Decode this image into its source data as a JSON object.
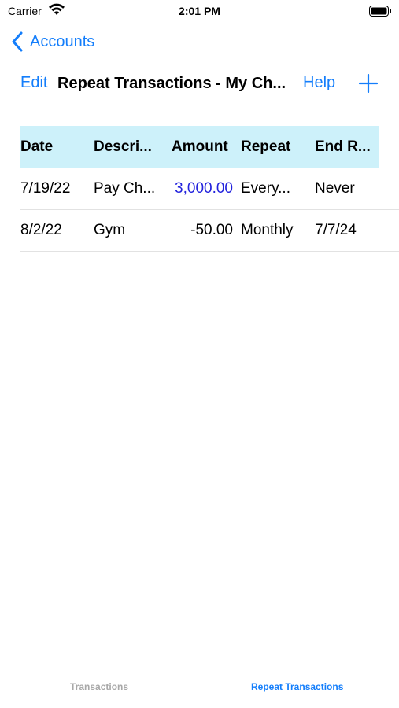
{
  "status_bar": {
    "carrier": "Carrier",
    "time": "2:01 PM"
  },
  "nav": {
    "back_label": "Accounts"
  },
  "toolbar": {
    "edit_label": "Edit",
    "title": "Repeat Transactions - My Ch...",
    "help_label": "Help"
  },
  "table": {
    "headers": {
      "date": "Date",
      "description": "Descri...",
      "amount": "Amount",
      "repeat": "Repeat",
      "end": "End R..."
    },
    "rows": [
      {
        "date": "7/19/22",
        "description": "Pay Ch...",
        "amount": "3,000.00",
        "repeat": "Every...",
        "end": "Never"
      },
      {
        "date": "8/2/22",
        "description": "Gym",
        "amount": "-50.00",
        "repeat": "Monthly",
        "end": "7/7/24"
      }
    ]
  },
  "tabbar": {
    "tabs": [
      {
        "label": "Transactions",
        "active": false
      },
      {
        "label": "Repeat Transactions",
        "active": true
      }
    ]
  },
  "colors": {
    "accent": "#147efb",
    "header_bg": "#cdf1fa",
    "positive_amount": "#2222dd",
    "inactive_tab": "#a8a8a8"
  }
}
